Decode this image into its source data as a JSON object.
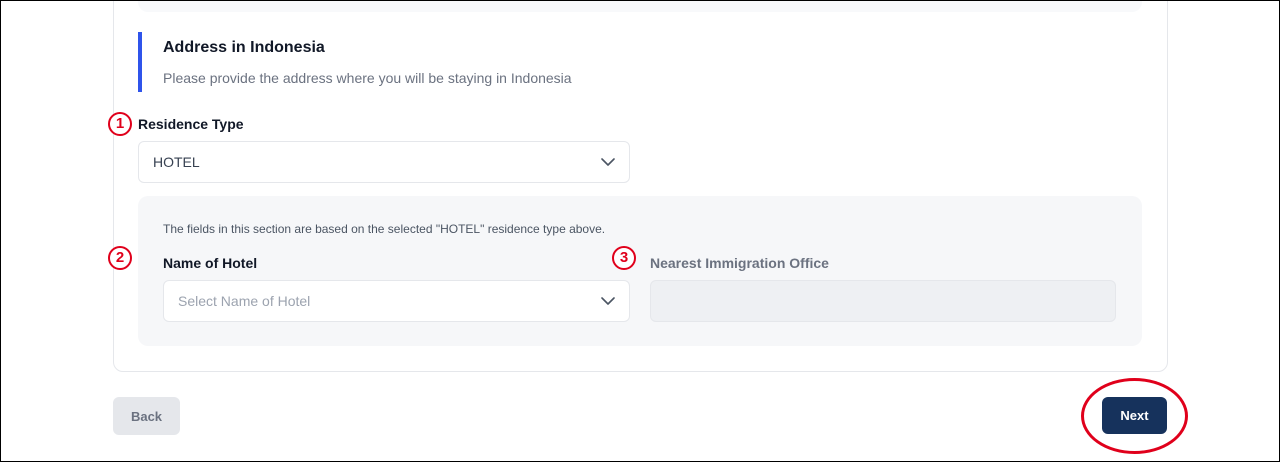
{
  "section": {
    "title": "Address in Indonesia",
    "subtitle": "Please provide the address where you will be staying in Indonesia"
  },
  "markers": [
    "1",
    "2",
    "3"
  ],
  "residence_type": {
    "label": "Residence Type",
    "value": "HOTEL"
  },
  "hotel_section": {
    "note": "The fields in this section are based on the selected \"HOTEL\" residence type above.",
    "hotel_name": {
      "label": "Name of Hotel",
      "placeholder": "Select Name of Hotel"
    },
    "immigration_office": {
      "label": "Nearest Immigration Office",
      "value": ""
    }
  },
  "actions": {
    "back_label": "Back",
    "next_label": "Next"
  },
  "colors": {
    "accent": "#2f54eb",
    "primary_button": "#16325c",
    "annotation": "#e0001b"
  }
}
